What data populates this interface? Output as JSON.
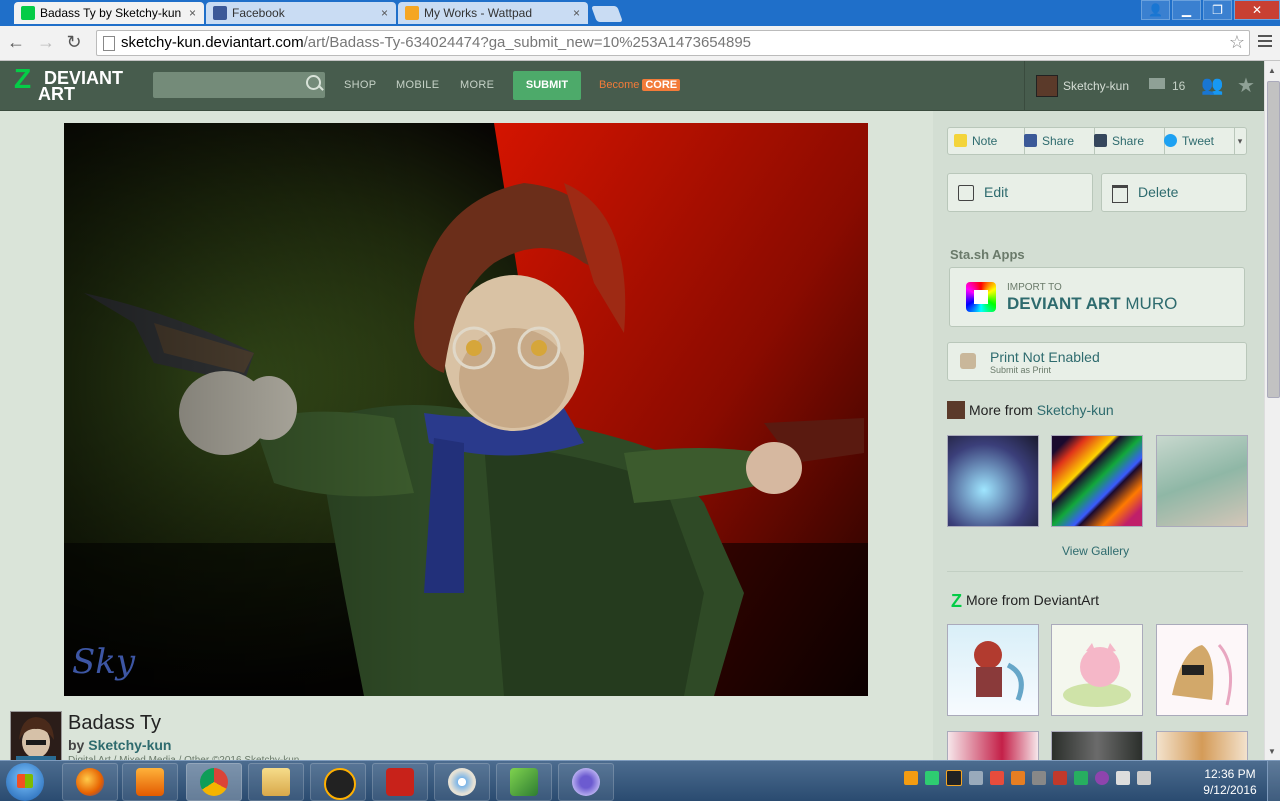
{
  "browser": {
    "tabs": [
      {
        "title": "Badass Ty by Sketchy-kun",
        "close": "×"
      },
      {
        "title": "Facebook",
        "close": "×"
      },
      {
        "title": "My Works - Wattpad",
        "close": "×"
      }
    ],
    "url_domain": "sketchy-kun.deviantart.com",
    "url_path": "/art/Badass-Ty-634024474?ga_submit_new=10%253A1473654895",
    "back": "←",
    "forward": "→",
    "reload": "↻",
    "bookmark_star": "☆",
    "win_minimize": "▁",
    "win_restore": "❐",
    "win_close": "✕",
    "win_user": "👤"
  },
  "header": {
    "logo_top": "DEVIANT",
    "logo_bottom": "ART",
    "logo_mark": "Z",
    "nav": [
      "SHOP",
      "MOBILE",
      "MORE"
    ],
    "submit": "SUBMIT",
    "become": "Become",
    "core": "CORE",
    "username": "Sketchy-kun",
    "notes_count": "16",
    "watch_icon": "👥",
    "fav_icon": "★"
  },
  "deviation": {
    "title": "Badass Ty",
    "by": "by",
    "author": "Sketchy-kun",
    "meta": "Digital Art / Mixed Media / Other   ©2016 Sketchy-kun",
    "signature": "Sky"
  },
  "sidebar": {
    "share": [
      "Note",
      "Share",
      "Share",
      "Tweet"
    ],
    "edit": "Edit",
    "delete": "Delete",
    "stash_apps": "Sta.sh Apps",
    "muro_import": "IMPORT TO",
    "muro_brand": "DEVIANT ART",
    "muro_name": "MURO",
    "print_title": "Print Not Enabled",
    "print_sub": "Submit as Print",
    "more_from": "More from",
    "more_from_user": "Sketchy-kun",
    "view_gallery": "View Gallery",
    "more_from_da": "More from DeviantArt"
  },
  "taskbar": {
    "time": "12:36 PM",
    "date": "9/12/2016"
  },
  "colors": {
    "da_green": "#05cc47",
    "header_bg": "#475c4d",
    "submit_bg": "#4daa6a",
    "core_orange": "#f37b39",
    "link_teal": "#2e6b6e"
  }
}
